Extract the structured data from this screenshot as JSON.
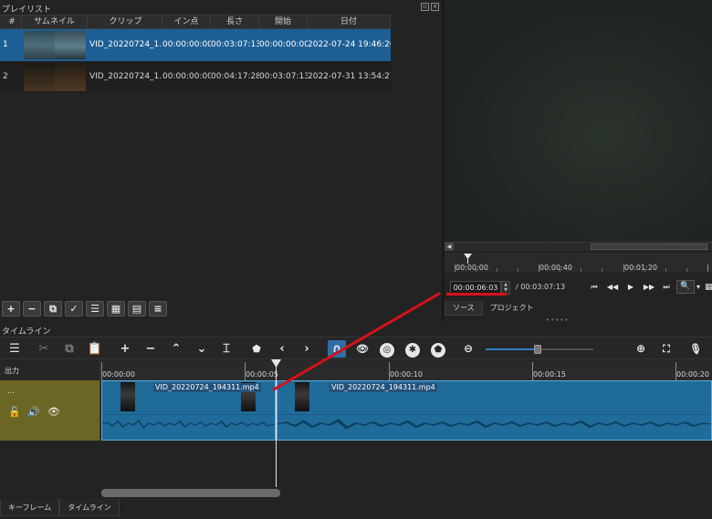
{
  "playlist": {
    "title": "プレイリスト",
    "columns": [
      "#",
      "サムネイル",
      "クリップ",
      "イン点",
      "長さ",
      "開始",
      "日付"
    ],
    "rows": [
      {
        "num": "1",
        "clip": "VID_20220724_1...",
        "in": "00:00:00:00",
        "length": "00:03:07:13",
        "start": "00:00:00:00",
        "date": "2022-07-24 19:46:20",
        "selected": true
      },
      {
        "num": "2",
        "clip": "VID_20220724_1...",
        "in": "00:00:00:00",
        "length": "00:04:17:28",
        "start": "00:03:07:13",
        "date": "2022-07-31 13:54:27",
        "selected": false
      }
    ],
    "toolbar_icons": [
      "add-icon",
      "remove-icon",
      "update-icon",
      "check-icon",
      "list-view-icon",
      "tile-view-icon",
      "icon-view-icon",
      "menu-icon"
    ]
  },
  "viewer": {
    "ruler_labels": [
      "00:00:00",
      "00:00:40",
      "00:01:20"
    ],
    "current_timecode": "00:00:06:03",
    "total_duration": "/ 00:03:07:13",
    "tabs": [
      "ソース",
      "プロジェクト"
    ],
    "active_tab": 0
  },
  "timeline": {
    "title": "タイムライン",
    "output_label": "出力",
    "track_name": "...",
    "ruler_labels": [
      "00:00:00",
      "00:00:05",
      "00:00:10",
      "00:00:15",
      "00:00:20"
    ],
    "clips": [
      {
        "name": "VID_20220724_194311.mp4"
      },
      {
        "name": "VID_20220724_194311.mp4"
      }
    ],
    "zoom_level_percent": 49,
    "bottom_tabs": [
      "キーフレーム",
      "タイムライン"
    ]
  },
  "annotation": {
    "color": "#d8101c"
  },
  "colors": {
    "selection": "#1d5f94",
    "clip": "#1f6b99",
    "track_head": "#6b6624",
    "accent": "#2f7fc4"
  }
}
